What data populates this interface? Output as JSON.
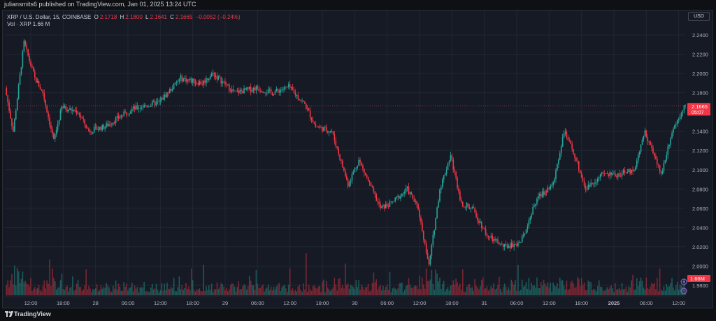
{
  "header": {
    "published_line": "juliansmits6 published on TradingView.com, Jan 01, 2025 13:24 UTC"
  },
  "legend": {
    "symbol_line": "XRP / U.S. Dollar, 15, COINBASE",
    "o_label": "O",
    "o_value": "2.1718",
    "h_label": "H",
    "h_value": "2.1800",
    "l_label": "L",
    "l_value": "2.1641",
    "c_label": "C",
    "c_value": "2.1665",
    "change": "−0.0052 (−0.24%)",
    "vol_label": "Vol · XRP",
    "vol_value": "1.66 M"
  },
  "toolbar": {
    "currency": "USD"
  },
  "footer": {
    "brand": "TradingView"
  },
  "colors": {
    "up": "#26a69a",
    "down": "#f23645",
    "background": "#161a25",
    "grid": "#232733",
    "axis_text": "#b2b5be"
  },
  "chart_data": {
    "type": "candlestick",
    "title": "XRP / U.S. Dollar, 15, COINBASE",
    "ylim": [
      1.97,
      2.245
    ],
    "y_ticks": [
      "2.2400",
      "2.2200",
      "2.2000",
      "2.1800",
      "2.1600",
      "2.1400",
      "2.1200",
      "2.1000",
      "2.0800",
      "2.0600",
      "2.0400",
      "2.0200",
      "2.0000",
      "1.9800"
    ],
    "x_ticks": [
      "12:00",
      "18:00",
      "28",
      "06:00",
      "12:00",
      "18:00",
      "29",
      "06:00",
      "12:00",
      "18:00",
      "30",
      "06:00",
      "12:00",
      "18:00",
      "31",
      "06:00",
      "12:00",
      "18:00",
      "2025",
      "06:00",
      "12:00"
    ],
    "price_path": [
      {
        "t": "Dec 27 07:30",
        "price": 2.185
      },
      {
        "t": "Dec 27 09:00",
        "price": 2.14
      },
      {
        "t": "Dec 27 11:00",
        "price": 2.232
      },
      {
        "t": "Dec 27 13:00",
        "price": 2.195
      },
      {
        "t": "Dec 27 14:30",
        "price": 2.18
      },
      {
        "t": "Dec 27 16:30",
        "price": 2.13
      },
      {
        "t": "Dec 27 18:00",
        "price": 2.165
      },
      {
        "t": "Dec 27 21:00",
        "price": 2.16
      },
      {
        "t": "Dec 27 23:00",
        "price": 2.14
      },
      {
        "t": "Dec 28 02:00",
        "price": 2.145
      },
      {
        "t": "Dec 28 07:00",
        "price": 2.163
      },
      {
        "t": "Dec 28 12:00",
        "price": 2.17
      },
      {
        "t": "Dec 28 16:00",
        "price": 2.195
      },
      {
        "t": "Dec 28 20:00",
        "price": 2.19
      },
      {
        "t": "Dec 28 22:00",
        "price": 2.2
      },
      {
        "t": "Dec 29 02:00",
        "price": 2.18
      },
      {
        "t": "Dec 29 06:00",
        "price": 2.185
      },
      {
        "t": "Dec 29 09:00",
        "price": 2.18
      },
      {
        "t": "Dec 29 12:00",
        "price": 2.186
      },
      {
        "t": "Dec 29 15:00",
        "price": 2.168
      },
      {
        "t": "Dec 29 17:00",
        "price": 2.145
      },
      {
        "t": "Dec 29 20:00",
        "price": 2.14
      },
      {
        "t": "Dec 29 23:00",
        "price": 2.085
      },
      {
        "t": "Dec 30 01:00",
        "price": 2.11
      },
      {
        "t": "Dec 30 05:00",
        "price": 2.06
      },
      {
        "t": "Dec 30 07:00",
        "price": 2.065
      },
      {
        "t": "Dec 30 10:00",
        "price": 2.08
      },
      {
        "t": "Dec 30 12:00",
        "price": 2.06
      },
      {
        "t": "Dec 30 14:00",
        "price": 2.0
      },
      {
        "t": "Dec 30 16:00",
        "price": 2.08
      },
      {
        "t": "Dec 30 18:00",
        "price": 2.115
      },
      {
        "t": "Dec 30 20:00",
        "price": 2.065
      },
      {
        "t": "Dec 30 22:00",
        "price": 2.06
      },
      {
        "t": "Dec 31 01:00",
        "price": 2.03
      },
      {
        "t": "Dec 31 04:00",
        "price": 2.02
      },
      {
        "t": "Dec 31 07:00",
        "price": 2.025
      },
      {
        "t": "Dec 31 10:00",
        "price": 2.07
      },
      {
        "t": "Dec 31 13:00",
        "price": 2.085
      },
      {
        "t": "Dec 31 15:00",
        "price": 2.14
      },
      {
        "t": "Dec 31 17:00",
        "price": 2.115
      },
      {
        "t": "Dec 31 19:00",
        "price": 2.08
      },
      {
        "t": "Dec 31 22:00",
        "price": 2.095
      },
      {
        "t": "Jan 01 01:00",
        "price": 2.095
      },
      {
        "t": "Jan 01 04:00",
        "price": 2.1
      },
      {
        "t": "Jan 01 06:00",
        "price": 2.14
      },
      {
        "t": "Jan 01 09:00",
        "price": 2.095
      },
      {
        "t": "Jan 01 11:00",
        "price": 2.14
      },
      {
        "t": "Jan 01 13:15",
        "price": 2.1665
      }
    ],
    "last_price": "2.1665",
    "last_price_countdown": "05:07",
    "current_volume": "1.66M"
  }
}
